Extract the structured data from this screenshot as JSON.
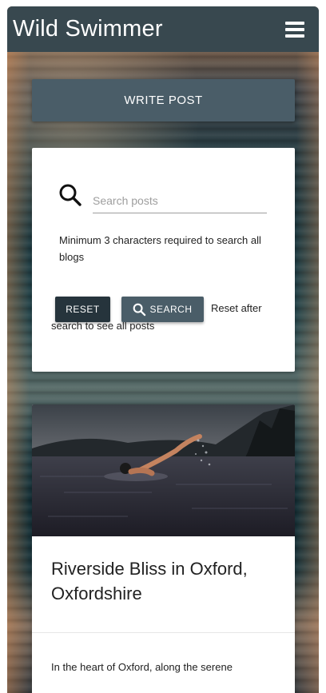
{
  "navbar": {
    "brand": "Wild Swimmer",
    "menu_icon": "hamburger-menu-icon"
  },
  "actions": {
    "write_post_label": "WRITE POST"
  },
  "search": {
    "icon": "search-icon",
    "placeholder": "Search posts",
    "value": "",
    "hint": "Minimum 3 characters required to search all blogs",
    "reset_label": "RESET",
    "search_label": "SEARCH",
    "reset_note": "Reset after search to see all posts"
  },
  "posts": [
    {
      "image": "wild-swimmer-photo",
      "title": "Riverside Bliss in Oxford, Oxfordshire",
      "excerpt": "In the heart of Oxford, along the serene"
    }
  ],
  "colors": {
    "navbar": "#38484f",
    "primary_button": "#4a5d68",
    "dark_button": "#26343c",
    "card": "#ffffff"
  }
}
